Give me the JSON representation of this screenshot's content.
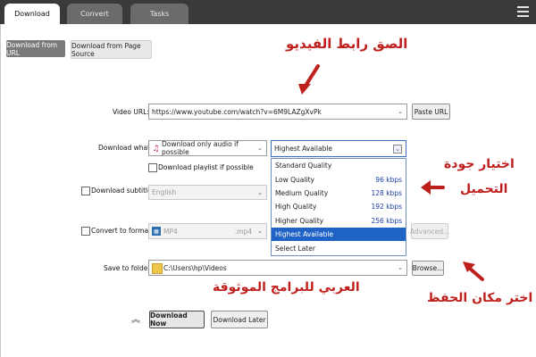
{
  "tabs": [
    "Download",
    "Convert",
    "Tasks"
  ],
  "source_buttons": {
    "from_url": "Download from URL",
    "from_page_source": "Download from Page Source"
  },
  "video_url": {
    "label": "Video URL:",
    "value": "https://www.youtube.com/watch?v=6M9LAZgXvPk",
    "paste_button": "Paste URL"
  },
  "download_what": {
    "label": "Download what:",
    "value": "Download only audio if possible"
  },
  "quality": {
    "value": "Highest Available",
    "options": [
      {
        "label": "Standard Quality",
        "rate": ""
      },
      {
        "label": "Low Quality",
        "rate": "96 kbps"
      },
      {
        "label": "Medium Quality",
        "rate": "128 kbps"
      },
      {
        "label": "High Quality",
        "rate": "192 kbps"
      },
      {
        "label": "Higher Quality",
        "rate": "256 kbps"
      },
      {
        "label": "Highest Available",
        "rate": ""
      },
      {
        "label": "Select Later",
        "rate": ""
      }
    ],
    "selected_index": 5
  },
  "playlist": {
    "label": "Download playlist if possible"
  },
  "subtitles": {
    "label": "Download subtitles:",
    "value": "English"
  },
  "convert": {
    "label": "Convert to format:",
    "value": "MP4",
    "ext": ".mp4",
    "advanced_button": "Advanced..."
  },
  "save_folder": {
    "label": "Save to folder:",
    "value": "C:\\Users\\hp\\Videos",
    "browse_button": "Browse..."
  },
  "actions": {
    "download_now": "Download Now",
    "download_later": "Download Later"
  },
  "annotations": {
    "paste_link": "الصق رابط الفيديو",
    "choose_quality_line1": "اختيار جودة",
    "choose_quality_line2": "التحميل",
    "choose_location": "اختر مكان الحفظ",
    "watermark": "العربي للبرامج الموثوقة"
  },
  "colors": {
    "selected_row": "#1f63c7",
    "annotation_red": "#c0201d",
    "topbar": "#3a3a3a"
  }
}
